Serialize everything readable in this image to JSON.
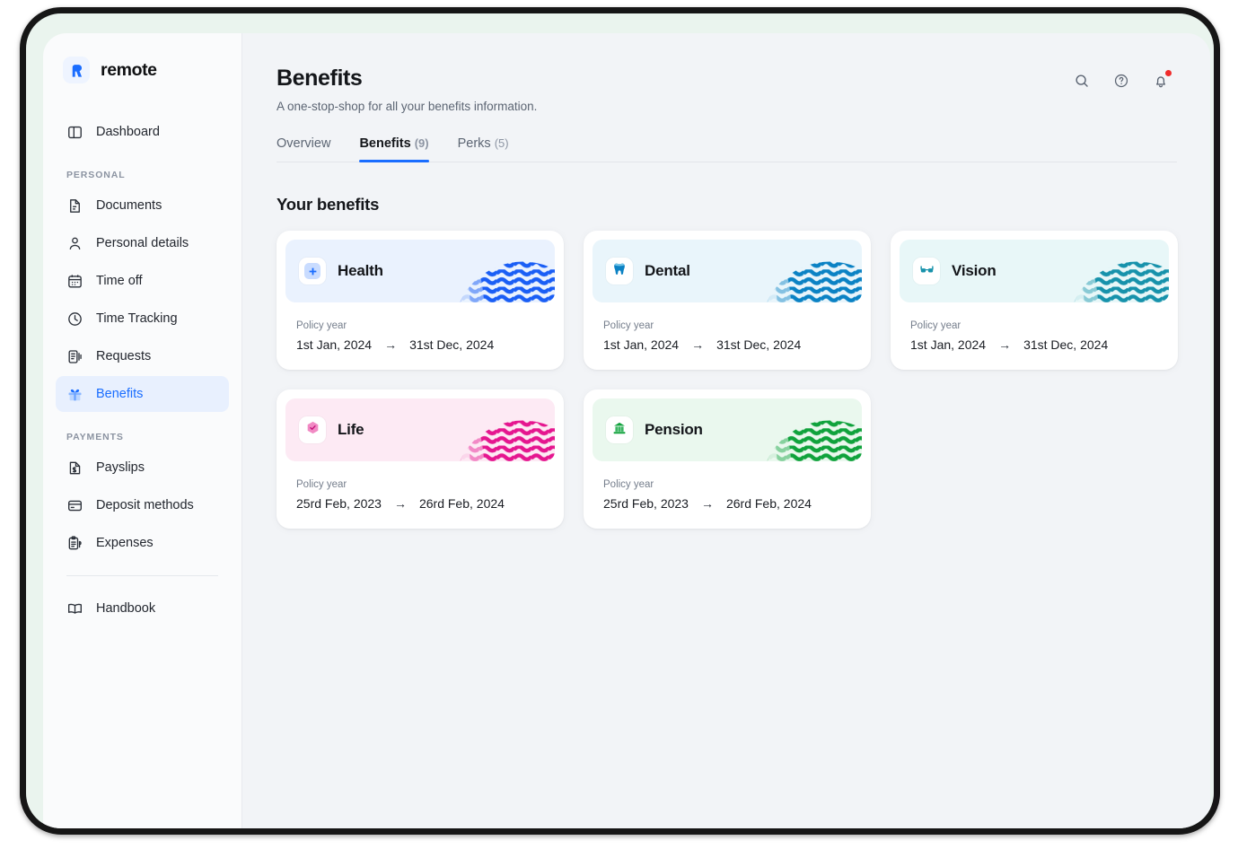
{
  "brand": {
    "name": "remote",
    "logo_icon": "remote-r-logo",
    "accent": "#1a6dff"
  },
  "sidebar": {
    "top_items": [
      {
        "label": "Dashboard",
        "icon": "dashboard-panel-icon",
        "active": false
      }
    ],
    "groups": [
      {
        "label": "PERSONAL",
        "items": [
          {
            "label": "Documents",
            "icon": "document-icon",
            "active": false
          },
          {
            "label": "Personal details",
            "icon": "person-icon",
            "active": false
          },
          {
            "label": "Time off",
            "icon": "calendar-icon",
            "active": false
          },
          {
            "label": "Time Tracking",
            "icon": "clock-icon",
            "active": false
          },
          {
            "label": "Requests",
            "icon": "requests-icon",
            "active": false
          },
          {
            "label": "Benefits",
            "icon": "gift-icon",
            "active": true
          }
        ]
      },
      {
        "label": "PAYMENTS",
        "items": [
          {
            "label": "Payslips",
            "icon": "payslip-dollar-icon",
            "active": false
          },
          {
            "label": "Deposit methods",
            "icon": "card-icon",
            "active": false
          },
          {
            "label": "Expenses",
            "icon": "expenses-clipboard-icon",
            "active": false
          }
        ]
      }
    ],
    "footer_items": [
      {
        "label": "Handbook",
        "icon": "book-icon",
        "active": false
      }
    ]
  },
  "header": {
    "title": "Benefits",
    "subtitle": "A one-stop-shop for all your benefits information.",
    "actions": [
      {
        "name": "search-icon",
        "label": "Search"
      },
      {
        "name": "help-icon",
        "label": "Help"
      },
      {
        "name": "notifications-bell-icon",
        "label": "Notifications",
        "has_badge": true
      }
    ]
  },
  "tabs": [
    {
      "label": "Overview",
      "count": "",
      "active": false
    },
    {
      "label": "Benefits",
      "count": "(9)",
      "active": true
    },
    {
      "label": "Perks",
      "count": "(5)",
      "active": false
    }
  ],
  "main": {
    "section_title": "Your benefits",
    "policy_label": "Policy year",
    "date_arrow": "→"
  },
  "benefits": [
    {
      "name": "Health",
      "icon": "medical-cross-icon",
      "banner_bg": "#eaf2fe",
      "sphere_color": "#1a5ef5",
      "icon_color": "#1a6dff",
      "icon_tile_bg": "#c9dcff",
      "start_date": "1st Jan, 2024",
      "end_date": "31st Dec, 2024"
    },
    {
      "name": "Dental",
      "icon": "tooth-icon",
      "banner_bg": "#e9f5fb",
      "sphere_color": "#0b82c4",
      "icon_color": "#0b82c4",
      "icon_tile_bg": "#ffffff",
      "start_date": "1st Jan, 2024",
      "end_date": "31st Dec, 2024"
    },
    {
      "name": "Vision",
      "icon": "glasses-icon",
      "banner_bg": "#e8f7f8",
      "sphere_color": "#1792ab",
      "icon_color": "#1792ab",
      "icon_tile_bg": "#ffffff",
      "start_date": "1st Jan, 2024",
      "end_date": "31st Dec, 2024"
    },
    {
      "name": "Life",
      "icon": "life-shield-icon",
      "banner_bg": "#fdeaf4",
      "sphere_color": "#e5168f",
      "icon_color": "#e5168f",
      "icon_tile_bg": "#f9b8da",
      "start_date": "25rd Feb, 2023",
      "end_date": "26rd Feb, 2024"
    },
    {
      "name": "Pension",
      "icon": "pension-bank-icon",
      "banner_bg": "#eaf8ee",
      "sphere_color": "#10a23c",
      "icon_color": "#10a23c",
      "icon_tile_bg": "#ffffff",
      "start_date": "25rd Feb, 2023",
      "end_date": "26rd Feb, 2024"
    }
  ]
}
